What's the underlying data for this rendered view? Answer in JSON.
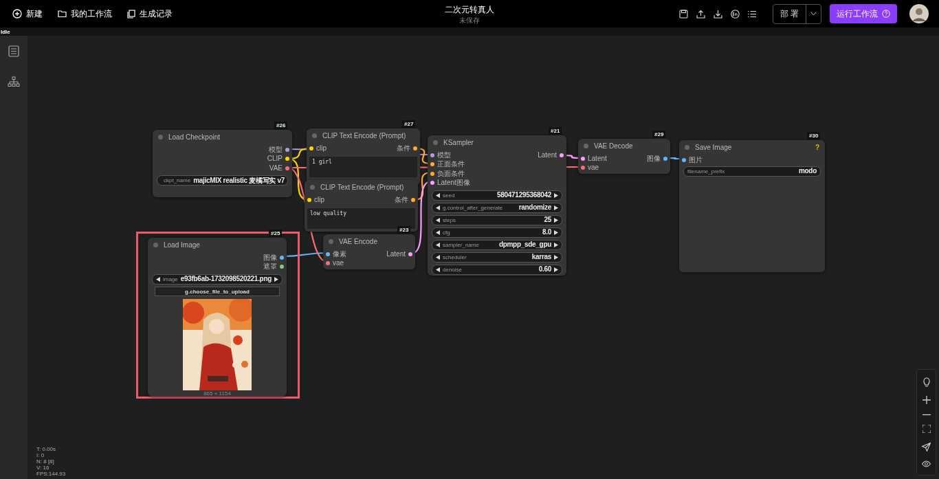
{
  "topbar": {
    "left_items": [
      {
        "label": "新建"
      },
      {
        "label": "我的工作流"
      },
      {
        "label": "生成记录"
      }
    ],
    "title": "二次元转真人",
    "subtitle": "未保存",
    "deploy_button": "部 署",
    "run_button": "运行工作流"
  },
  "status": "Idle",
  "nodes": [
    {
      "id": "#26",
      "title": "Load Checkpoint",
      "selected": false,
      "outputs": [
        {
          "label": "模型",
          "color": "#b39ddb"
        },
        {
          "label": "CLIP",
          "color": "#ffd500"
        },
        {
          "label": "VAE",
          "color": "#ff6e6e"
        }
      ],
      "widgets": [
        {
          "kind": "combo",
          "name": "ckpt_name",
          "value": "majicMIX realistic 麦橘写实 v7"
        }
      ]
    },
    {
      "id": "#27",
      "title": "CLIP Text Encode (Prompt)",
      "selected": false,
      "inputs": [
        {
          "label": "clip",
          "color": "#ffd500"
        }
      ],
      "outputs": [
        {
          "label": "条件",
          "color": "#ffa931"
        }
      ],
      "widgets": [
        {
          "kind": "text",
          "value": "1 girl"
        }
      ]
    },
    {
      "title": "CLIP Text Encode (Prompt)",
      "selected": false,
      "inputs": [
        {
          "label": "clip",
          "color": "#ffd500"
        }
      ],
      "outputs": [
        {
          "label": "条件",
          "color": "#ffa931"
        }
      ],
      "widgets": [
        {
          "kind": "text",
          "value": "low quality"
        }
      ]
    },
    {
      "id": "#25",
      "title": "Load Image",
      "selected": true,
      "outputs": [
        {
          "label": "图像",
          "color": "#64b5f6"
        },
        {
          "label": "遮罩",
          "color": "#81c784"
        }
      ],
      "widgets": [
        {
          "kind": "combo",
          "name": "image",
          "value": "e93fb6ab-1732098520221.png"
        },
        {
          "kind": "button",
          "value": "g.choose_file_to_upload"
        },
        {
          "kind": "picture"
        }
      ],
      "caption": "865 × 1154"
    },
    {
      "id": "#23",
      "title": "VAE Encode",
      "selected": false,
      "inputs": [
        {
          "label": "像素",
          "color": "#64b5f6"
        },
        {
          "label": "vae",
          "color": "#ff6e6e"
        }
      ],
      "outputs": [
        {
          "label": "Latent",
          "color": "#ff9cf9"
        }
      ]
    },
    {
      "id": "#21",
      "title": "KSampler",
      "selected": false,
      "inputs": [
        {
          "label": "模型",
          "color": "#b39ddb"
        },
        {
          "label": "正面条件",
          "color": "#ffa931"
        },
        {
          "label": "负面条件",
          "color": "#ffa931"
        },
        {
          "label": "Latent图像",
          "color": "#ff9cf9"
        }
      ],
      "outputs": [
        {
          "label": "Latent",
          "color": "#ff9cf9"
        }
      ],
      "widgets": [
        {
          "kind": "combo",
          "name": "seed",
          "value": "580471295368042"
        },
        {
          "kind": "combo",
          "name": "g.control_after_generate",
          "value": "randomize"
        },
        {
          "kind": "combo",
          "name": "steps",
          "value": "25"
        },
        {
          "kind": "combo",
          "name": "cfg",
          "value": "8.0"
        },
        {
          "kind": "combo",
          "name": "sampler_name",
          "value": "dpmpp_sde_gpu"
        },
        {
          "kind": "combo",
          "name": "scheduler",
          "value": "karras"
        },
        {
          "kind": "combo",
          "name": "denoise",
          "value": "0.60"
        }
      ]
    },
    {
      "id": "#29",
      "title": "VAE Decode",
      "selected": false,
      "inputs": [
        {
          "label": "Latent",
          "color": "#ff9cf9"
        },
        {
          "label": "vae",
          "color": "#ff6e6e"
        }
      ],
      "outputs": [
        {
          "label": "图像",
          "color": "#64b5f6"
        }
      ]
    },
    {
      "id": "#30",
      "title": "Save Image",
      "selected": false,
      "badge": "?",
      "inputs": [
        {
          "label": "图片",
          "color": "#64b5f6"
        }
      ],
      "widgets": [
        {
          "kind": "field",
          "name": "filename_prefix",
          "value": "modo"
        }
      ]
    }
  ],
  "stats": [
    "T: 0.00s",
    "I: 0",
    "N: 8 [8]",
    "V: 16",
    "FPS:144.93"
  ]
}
